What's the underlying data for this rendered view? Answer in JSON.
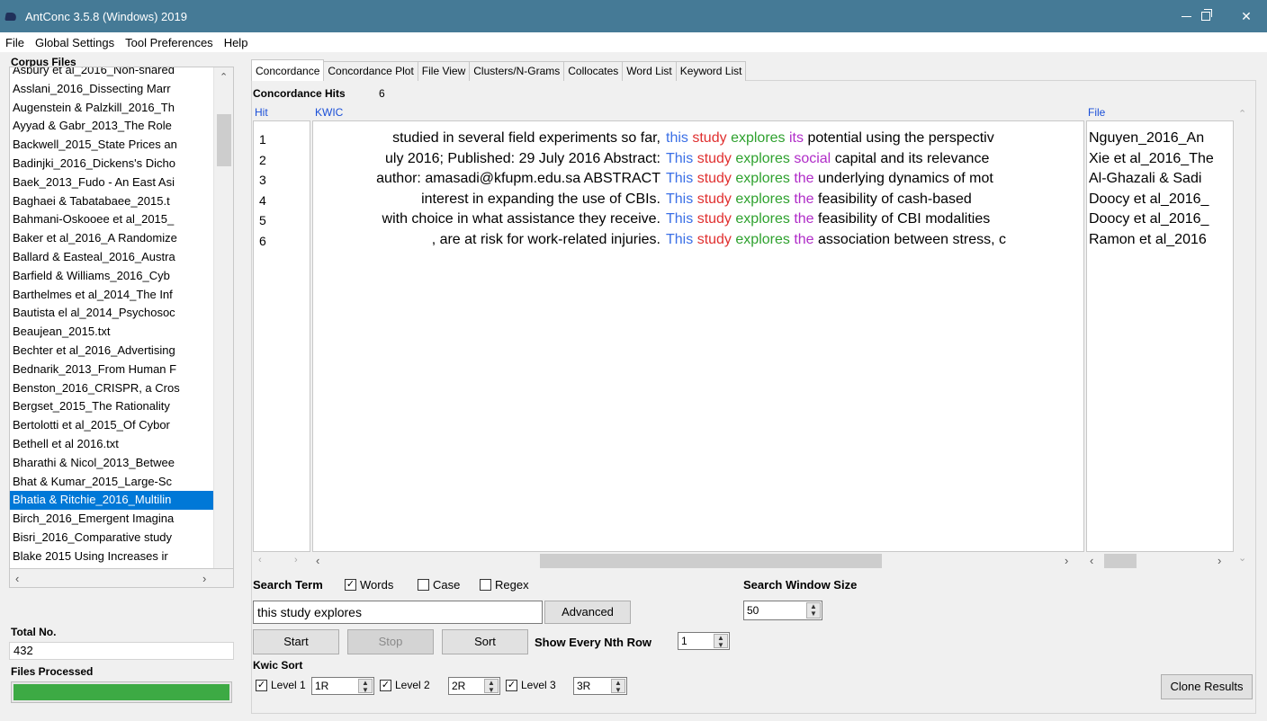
{
  "window": {
    "title": "AntConc 3.5.8 (Windows) 2019"
  },
  "menu": [
    "File",
    "Global Settings",
    "Tool Preferences",
    "Help"
  ],
  "corpus": {
    "label": "Corpus Files",
    "files": [
      "Asbury et al_2016_Non-shared",
      "Asslani_2016_Dissecting Marr",
      "Augenstein & Palzkill_2016_Th",
      "Ayyad & Gabr_2013_The Role",
      "Backwell_2015_State Prices an",
      "Badinjki_2016_Dickens's Dicho",
      "Baek_2013_Fudo - An East Asi",
      "Baghaei & Tabatabaee_2015.t",
      "Bahmani-Oskooee et al_2015_",
      "Baker et al_2016_A Randomize",
      "Ballard & Easteal_2016_Austra",
      "Barfield & Williams_2016_Cyb",
      "Barthelmes et al_2014_The Inf",
      "Bautista el al_2014_Psychosoc",
      "Beaujean_2015.txt",
      "Bechter et al_2016_Advertising",
      "Bednarik_2013_From Human F",
      "Benston_2016_CRISPR, a Cros",
      "Bergset_2015_The Rationality",
      "Bertolotti et al_2015_Of Cybor",
      "Bethell et al 2016.txt",
      "Bharathi & Nicol_2013_Betwee",
      "Bhat & Kumar_2015_Large-Sc",
      "Bhatia & Ritchie_2016_Multilin",
      "Birch_2016_Emergent Imagina",
      "Bisri_2016_Comparative study",
      "Blake 2015 Using Increases ir"
    ],
    "selected_index": 23,
    "total_label": "Total No.",
    "total_value": "432",
    "processed_label": "Files Processed",
    "progress": 1.0
  },
  "tabs": [
    "Concordance",
    "Concordance Plot",
    "File View",
    "Clusters/N-Grams",
    "Collocates",
    "Word List",
    "Keyword List"
  ],
  "active_tab": 0,
  "concordance": {
    "hits_label": "Concordance Hits",
    "hits_value": "6",
    "col_hit": "Hit",
    "col_kwic": "KWIC",
    "col_file": "File",
    "rows": [
      {
        "num": "1",
        "left": "studied in several field experiments so far,",
        "k1": "this",
        "k2": "study",
        "k3": "explores",
        "r1": "its",
        "rest": "potential using the perspectiv",
        "file": "Nguyen_2016_An"
      },
      {
        "num": "2",
        "left": "uly 2016; Published: 29 July 2016  Abstract:",
        "k1": "This",
        "k2": "study",
        "k3": "explores",
        "r1": "social",
        "rest": "capital and its relevance",
        "file": "Xie et al_2016_The"
      },
      {
        "num": "3",
        "left": "author: amasadi@kfupm.edu.sa  ABSTRACT",
        "k1": "This",
        "k2": "study",
        "k3": "explores",
        "r1": "the",
        "rest": "underlying dynamics of mot",
        "file": "Al-Ghazali & Sadi"
      },
      {
        "num": "4",
        "left": "interest in expanding the use of CBIs.",
        "k1": "This",
        "k2": "study",
        "k3": "explores",
        "r1": "the",
        "rest": "feasibility of cash-based",
        "file": "Doocy et al_2016_"
      },
      {
        "num": "5",
        "left": "with choice in what assistance they receive.",
        "k1": "This",
        "k2": "study",
        "k3": "explores",
        "r1": "the",
        "rest": "feasibility of CBI modalities",
        "file": "Doocy et al_2016_"
      },
      {
        "num": "6",
        "left": ", are at risk for work-related injuries.",
        "k1": "This",
        "k2": "study",
        "k3": "explores",
        "r1": "the",
        "rest": "association between stress, c",
        "file": "Ramon et al_2016"
      }
    ]
  },
  "search": {
    "label": "Search Term",
    "words_label": "Words",
    "words_checked": true,
    "case_label": "Case",
    "case_checked": false,
    "regex_label": "Regex",
    "regex_checked": false,
    "term": "this study explores",
    "advanced_label": "Advanced",
    "window_label": "Search Window Size",
    "window_value": "50",
    "start_label": "Start",
    "stop_label": "Stop",
    "sort_label": "Sort",
    "nth_label": "Show Every Nth Row",
    "nth_value": "1"
  },
  "kwic_sort": {
    "label": "Kwic Sort",
    "level1_label": "Level 1",
    "level1_value": "1R",
    "level2_label": "Level 2",
    "level2_value": "2R",
    "level3_label": "Level 3",
    "level3_value": "3R",
    "clone_label": "Clone Results"
  },
  "colors": {
    "titlebar": "#457a96",
    "selection": "#0078d7",
    "progress": "#3daa44",
    "header_blue": "#1a4fd8",
    "kw1": "#3a6fe6",
    "kw2": "#e03030",
    "kw3": "#2ea12e",
    "r1": "#b02cc8"
  }
}
